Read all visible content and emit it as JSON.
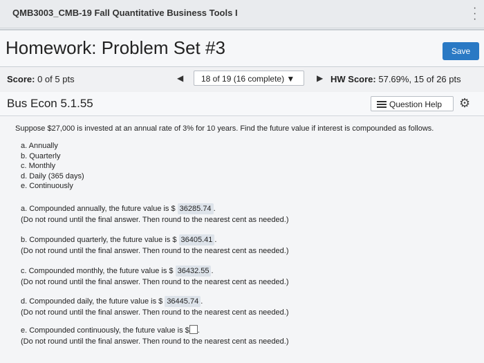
{
  "course": {
    "title": "QMB3003_CMB-19 Fall Quantitative Business Tools I"
  },
  "homework": {
    "title": "Homework: Problem Set #3",
    "save_label": "Save"
  },
  "scorebar": {
    "score_label": "Score:",
    "score_value": "0 of 5 pts",
    "nav_prev": "◀",
    "nav_select": "18 of 19 (16 complete) ▼",
    "nav_next": "▶",
    "hw_label": "HW Score:",
    "hw_value": "57.69%, 15 of 26 pts"
  },
  "question": {
    "id": "Bus Econ 5.1.55",
    "help_label": "Question Help",
    "prompt": "Suppose $27,000 is invested at an annual rate of 3% for 10 years. Find the future value if interest is compounded as follows.",
    "options": [
      "a. Annually",
      "b. Quarterly",
      "c. Monthly",
      "d. Daily (365 days)",
      "e. Continuously"
    ],
    "answers": [
      {
        "text": "a. Compounded annually, the future value is $ ",
        "value": "36285.74",
        "note": "(Do not round until the final answer. Then round to the nearest cent as needed.)"
      },
      {
        "text": "b. Compounded quarterly, the future value is $ ",
        "value": "36405.41",
        "note": "(Do not round until the final answer. Then round to the nearest cent as needed.)"
      },
      {
        "text": "c. Compounded monthly, the future value is $ ",
        "value": "36432.55",
        "note": "(Do not round until the final answer. Then round to the nearest cent as needed.)"
      },
      {
        "text": "d. Compounded daily, the future value is $ ",
        "value": "36445.74",
        "note": "(Do not round until the final answer. Then round to the nearest cent as needed.)"
      },
      {
        "text": "e. Compounded continuously, the future value is $",
        "value": "",
        "note": "(Do not round until the final answer. Then round to the nearest cent as needed.)"
      }
    ]
  }
}
